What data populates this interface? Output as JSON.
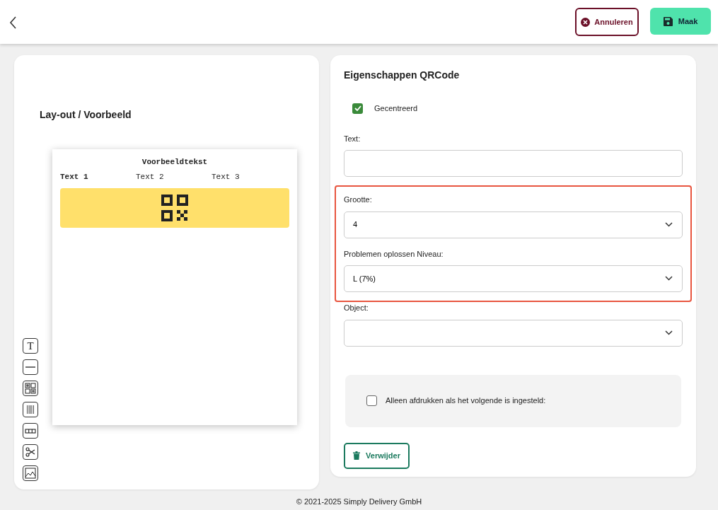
{
  "header": {
    "buttons": [
      {
        "kind": "cancel",
        "label": "Annuleren"
      },
      {
        "kind": "save",
        "label": "Maak"
      }
    ]
  },
  "preview": {
    "title": "Lay-out / Voorbeeld",
    "label_title": "Voorbeeldtekst",
    "texts": [
      {
        "text": "Text 1",
        "bold": true
      },
      {
        "text": "Text 2",
        "bold": false
      },
      {
        "text": "Text 3",
        "bold": false
      }
    ],
    "tools": [
      {
        "kind": "text",
        "label": "T"
      },
      {
        "kind": "line"
      },
      {
        "kind": "qr"
      },
      {
        "kind": "barcode"
      },
      {
        "kind": "table"
      },
      {
        "kind": "cut"
      },
      {
        "kind": "image"
      }
    ]
  },
  "properties": {
    "title": "Eigenschappen QRCode",
    "centered": {
      "label": "Gecentreerd",
      "checked": true
    },
    "text_field": {
      "label": "Text:"
    },
    "highlighted_group": {
      "highlighted": true,
      "fields": [
        {
          "label": "Grootte:",
          "value": "4"
        },
        {
          "label": "Problemen oplossen Niveau:",
          "value": "L (7%)"
        }
      ]
    },
    "object_field": {
      "label": "Object:"
    },
    "condition": {
      "label": "Alleen afdrukken als het volgende is ingesteld:",
      "checked": false
    },
    "delete_button": "Verwijder"
  },
  "footer": "© 2021-2025 Simply Delivery GmbH"
}
